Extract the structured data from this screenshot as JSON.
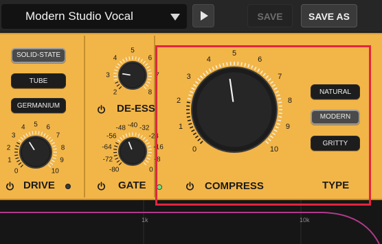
{
  "header": {
    "preset_name": "Modern Studio Vocal",
    "save_label": "SAVE",
    "save_as_label": "SAVE AS"
  },
  "character": {
    "options": [
      "SOLID-STATE",
      "TUBE",
      "GERMANIUM"
    ],
    "selected": "SOLID-STATE"
  },
  "drive": {
    "label": "DRIVE",
    "scale": [
      "0",
      "1",
      "2",
      "3",
      "4",
      "5",
      "6",
      "7",
      "8",
      "9",
      "10"
    ]
  },
  "deess": {
    "label": "DE-ESS",
    "scale": [
      "2",
      "3",
      "4",
      "5",
      "6",
      "7",
      "8"
    ]
  },
  "gate": {
    "label": "GATE",
    "scale": [
      "-80",
      "-72",
      "-64",
      "-56",
      "-48",
      "-40",
      "-32",
      "-24",
      "-16",
      "-8",
      "0"
    ]
  },
  "compress": {
    "label": "COMPRESS",
    "scale": [
      "0",
      "1",
      "2",
      "3",
      "4",
      "5",
      "6",
      "7",
      "8",
      "9",
      "10"
    ]
  },
  "type": {
    "label": "TYPE",
    "options": [
      "NATURAL",
      "MODERN",
      "GRITTY"
    ],
    "selected": "MODERN"
  },
  "analyzer": {
    "labels": [
      "1k",
      "10k"
    ]
  },
  "colors": {
    "panel": "#f2b548",
    "highlight": "#e12640",
    "knob": "#1c1c1c"
  }
}
